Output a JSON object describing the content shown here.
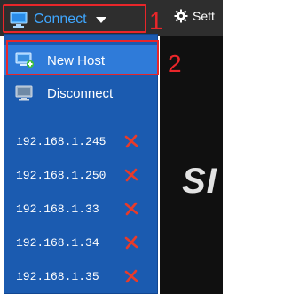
{
  "toolbar": {
    "connect_label": "Connect",
    "settings_label": "Sett",
    "connect_icon": "monitor-icon",
    "settings_icon": "gear-icon"
  },
  "annotations": {
    "step1": "1",
    "step2": "2",
    "color": "#e8262a"
  },
  "background": {
    "logo_fragment": "SI"
  },
  "menu": {
    "new_host_label": "New Host",
    "disconnect_label": "Disconnect",
    "hosts": [
      {
        "ip": "192.168.1.245"
      },
      {
        "ip": "192.168.1.250"
      },
      {
        "ip": "192.168.1.33"
      },
      {
        "ip": "192.168.1.34"
      },
      {
        "ip": "192.168.1.35"
      }
    ]
  },
  "colors": {
    "menu_bg": "#1b5bb0",
    "menu_highlight": "#2f7bd9",
    "connect_text": "#3fa7ff",
    "remove_x": "#e83b2a"
  }
}
